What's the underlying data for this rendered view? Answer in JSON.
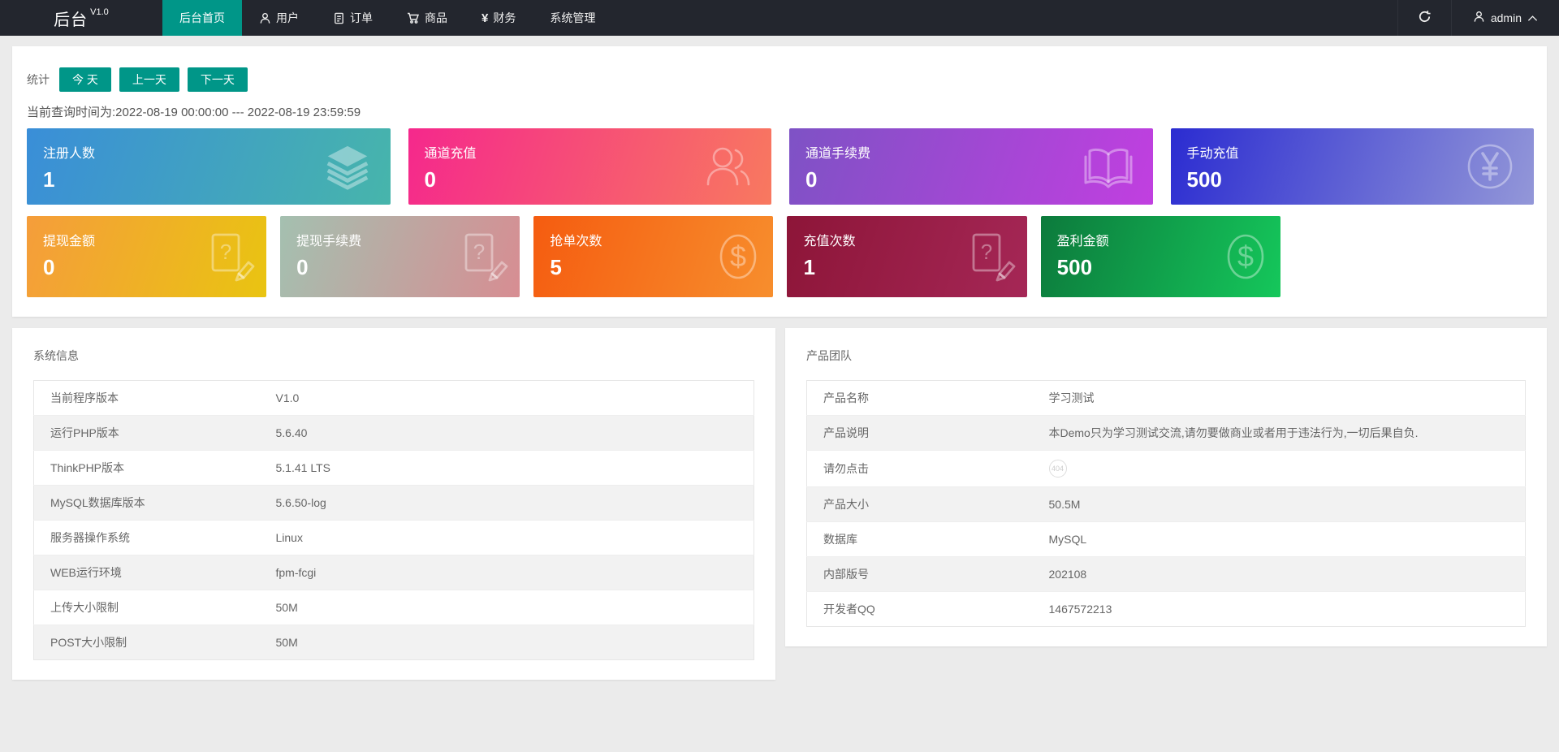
{
  "navbar": {
    "logo": "后台",
    "version": "V1.0",
    "items": [
      {
        "label": "后台首页",
        "active": true
      },
      {
        "label": "用户",
        "icon": "user-icon"
      },
      {
        "label": "订单",
        "icon": "order-icon"
      },
      {
        "label": "商品",
        "icon": "cart-icon"
      },
      {
        "label": "财务",
        "icon": "yen-icon",
        "icon_glyph": "¥"
      },
      {
        "label": "系统管理"
      }
    ],
    "username": "admin"
  },
  "stats": {
    "label": "统计",
    "buttons": [
      "今 天",
      "上一天",
      "下一天"
    ],
    "time_text": "当前查询时间为:2022-08-19 00:00:00 --- 2022-08-19 23:59:59"
  },
  "cards_row1": [
    {
      "label": "注册人数",
      "value": "1",
      "icon": "layers-icon",
      "gradient": [
        "#3a8ed8",
        "#47b5ab"
      ]
    },
    {
      "label": "通道充值",
      "value": "0",
      "icon": "users-icon",
      "gradient": [
        "#f5288c",
        "#f8795f"
      ]
    },
    {
      "label": "通道手续费",
      "value": "0",
      "icon": "open-book-icon",
      "gradient": [
        "#7e52c5",
        "#c13fe0"
      ]
    },
    {
      "label": "手动充值",
      "value": "500",
      "icon": "yen-circle-icon",
      "gradient": [
        "#2b2cd1",
        "#9397d8"
      ]
    }
  ],
  "cards_row2": [
    {
      "label": "提现金额",
      "value": "0",
      "icon": "file-question-icon",
      "gradient": [
        "#f59d3b",
        "#e9c411"
      ]
    },
    {
      "label": "提现手续费",
      "value": "0",
      "icon": "file-question-icon",
      "gradient": [
        "#a4c0b0",
        "#d78d92"
      ]
    },
    {
      "label": "抢单次数",
      "value": "5",
      "icon": "dollar-circle-icon",
      "gradient": [
        "#f55c10",
        "#f78e2d"
      ]
    },
    {
      "label": "充值次数",
      "value": "1",
      "icon": "file-question-icon",
      "gradient": [
        "#8d1538",
        "#a52756"
      ]
    },
    {
      "label": "盈利金额",
      "value": "500",
      "icon": "dollar-circle-icon",
      "gradient": [
        "#0c7a3c",
        "#15c75b"
      ]
    }
  ],
  "system_info": {
    "title": "系统信息",
    "rows": [
      {
        "label": "当前程序版本",
        "value": "V1.0"
      },
      {
        "label": "运行PHP版本",
        "value": "5.6.40"
      },
      {
        "label": "ThinkPHP版本",
        "value": "5.1.41 LTS"
      },
      {
        "label": "MySQL数据库版本",
        "value": "5.6.50-log"
      },
      {
        "label": "服务器操作系统",
        "value": "Linux"
      },
      {
        "label": "WEB运行环境",
        "value": "fpm-fcgi"
      },
      {
        "label": "上传大小限制",
        "value": "50M"
      },
      {
        "label": "POST大小限制",
        "value": "50M"
      }
    ]
  },
  "product_team": {
    "title": "产品团队",
    "rows": [
      {
        "label": "产品名称",
        "value": "学习测试"
      },
      {
        "label": "产品说明",
        "value": "本Demo只为学习测试交流,请勿要做商业或者用于违法行为,一切后果自负."
      },
      {
        "label": "请勿点击",
        "value": "",
        "badge": "404"
      },
      {
        "label": "产品大小",
        "value": "50.5M"
      },
      {
        "label": "数据库",
        "value": "MySQL"
      },
      {
        "label": "内部版号",
        "value": "202108"
      },
      {
        "label": "开发者QQ",
        "value": "1467572213"
      }
    ]
  },
  "colors": {
    "accent": "#009688",
    "navbar_bg": "#23262e",
    "page_bg": "#ebebeb"
  }
}
